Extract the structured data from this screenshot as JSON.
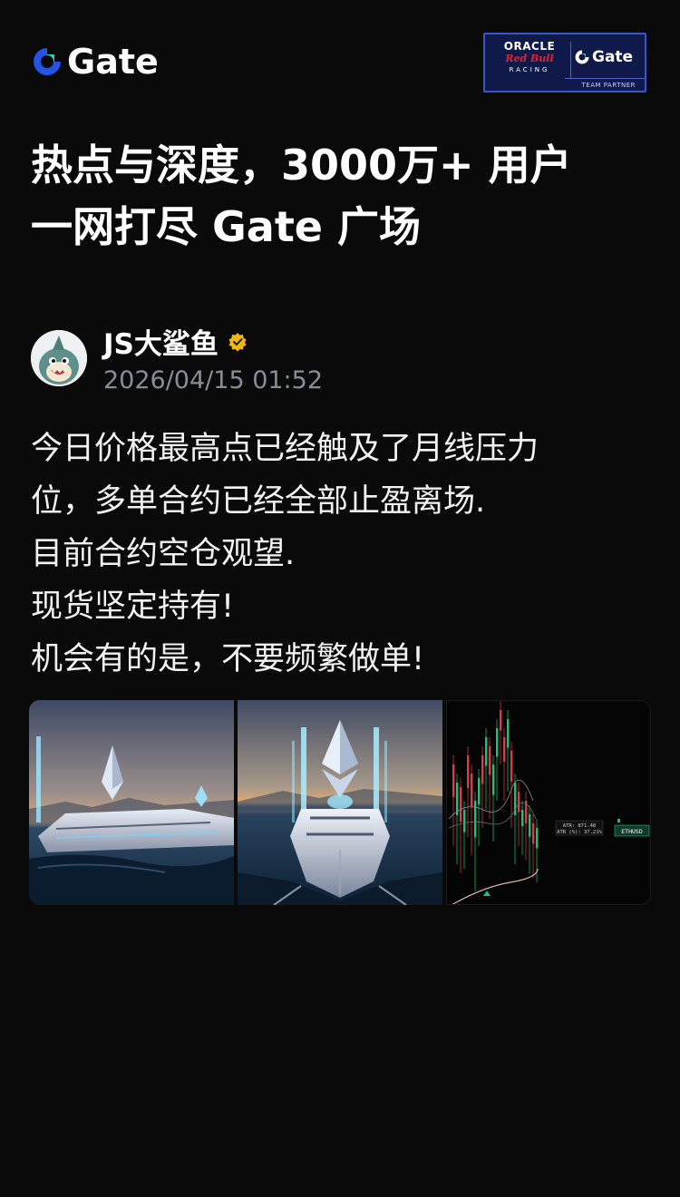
{
  "header": {
    "logo_text": "Gate",
    "logo_icon": "gate-logo-icon",
    "partner_badge": {
      "line1": "ORACLE",
      "line2": "Red Bull",
      "line3": "RACING",
      "brand": "Gate",
      "caption": "TEAM PARTNER"
    }
  },
  "headline": {
    "line1": "热点与深度，3000万+ 用户",
    "line2": "一网打尽 Gate 广场"
  },
  "post": {
    "author_name": "JS大鲨鱼",
    "verified_icon": "verified-badge-icon",
    "timestamp": "2026/04/15 01:52",
    "body_lines": [
      "今日价格最高点已经触及了月线压力",
      "位，多单合约已经全部止盈离场.",
      "目前合约空仓观望.",
      "现货坚定持有!",
      "机会有的是，不要频繁做单!"
    ],
    "images": [
      {
        "name": "yacht-ethereum-image-1"
      },
      {
        "name": "yacht-ethereum-image-2"
      },
      {
        "name": "eth-candlestick-chart-image",
        "labels": {
          "atr": "ATR: 871.48",
          "atr_pct": "ATR (%): 37.21%",
          "symbol": "ETHUSD"
        }
      }
    ]
  },
  "colors": {
    "background": "#0a0a0a",
    "accent_blue": "#2354e6",
    "verified_gold": "#f0b90b",
    "muted_text": "#8a8d93"
  }
}
